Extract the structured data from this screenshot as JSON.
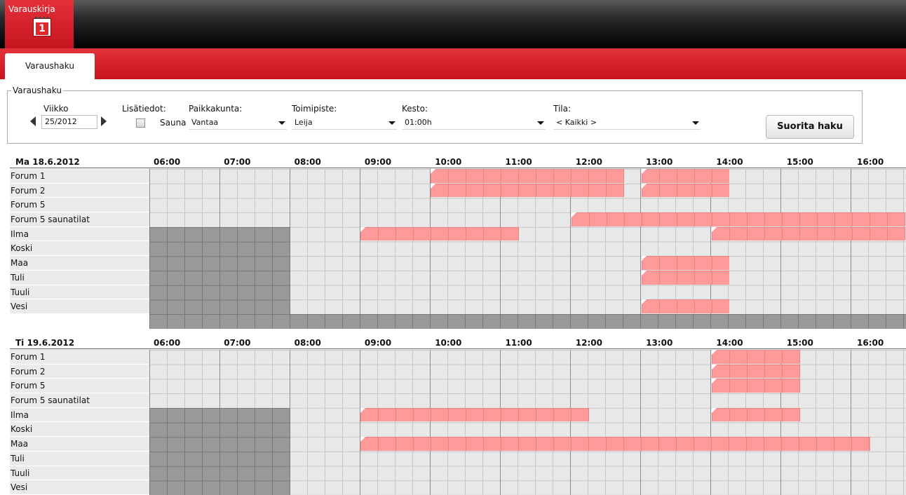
{
  "app": {
    "title": "Varauskirja",
    "calendar_day": "1"
  },
  "tabs": [
    {
      "label": "Varaushaku"
    }
  ],
  "search": {
    "legend": "Varaushaku",
    "week_label": "Viikko",
    "week_value": "25/2012",
    "extra_label": "Lisätiedot:",
    "sauna_label": "Sauna",
    "sauna_checked": false,
    "city_label": "Paikkakunta:",
    "city_value": "Vantaa",
    "office_label": "Toimipiste:",
    "office_value": "Leija",
    "duration_label": "Kesto:",
    "duration_value": "01:00h",
    "state_label": "Tila:",
    "state_value": "< Kaikki >",
    "submit_label": "Suorita haku"
  },
  "colors": {
    "accent": "#d41c25",
    "booking": "#ff9a9a",
    "unavailable": "#999999",
    "free": "#e8e8e8"
  },
  "hours": [
    "06:00",
    "07:00",
    "08:00",
    "09:00",
    "10:00",
    "11:00",
    "12:00",
    "13:00",
    "14:00",
    "15:00",
    "16:00"
  ],
  "days": [
    {
      "title": "Ma 18.6.2012",
      "rooms": [
        "Forum 1",
        "Forum 2",
        "Forum 5",
        "Forum 5 saunatilat",
        "Ilma",
        "Koski",
        "Maa",
        "Tuli",
        "Tuuli",
        "Vesi"
      ],
      "bookings": [
        {
          "room": "Forum 1",
          "start": "10:00",
          "end": "12:45"
        },
        {
          "room": "Forum 1",
          "start": "13:00",
          "end": "14:15"
        },
        {
          "room": "Forum 2",
          "start": "10:00",
          "end": "12:45"
        },
        {
          "room": "Forum 2",
          "start": "13:00",
          "end": "14:15"
        },
        {
          "room": "Forum 5 saunatilat",
          "start": "12:00",
          "end": "16:45"
        },
        {
          "room": "Ilma",
          "start": "09:00",
          "end": "11:15"
        },
        {
          "room": "Ilma",
          "start": "14:00",
          "end": "16:45"
        },
        {
          "room": "Maa",
          "start": "13:00",
          "end": "14:15"
        },
        {
          "room": "Tuli",
          "start": "13:00",
          "end": "14:15"
        },
        {
          "room": "Vesi",
          "start": "13:00",
          "end": "14:15"
        }
      ]
    },
    {
      "title": "Ti 19.6.2012",
      "rooms": [
        "Forum 1",
        "Forum 2",
        "Forum 5",
        "Forum 5 saunatilat",
        "Ilma",
        "Koski",
        "Maa",
        "Tuli",
        "Tuuli",
        "Vesi"
      ],
      "bookings": [
        {
          "room": "Forum 1",
          "start": "14:00",
          "end": "15:15"
        },
        {
          "room": "Forum 2",
          "start": "14:00",
          "end": "15:15"
        },
        {
          "room": "Forum 5",
          "start": "14:00",
          "end": "15:15"
        },
        {
          "room": "Ilma",
          "start": "09:00",
          "end": "12:15"
        },
        {
          "room": "Ilma",
          "start": "14:00",
          "end": "15:15"
        },
        {
          "room": "Maa",
          "start": "09:00",
          "end": "16:15"
        }
      ]
    }
  ]
}
